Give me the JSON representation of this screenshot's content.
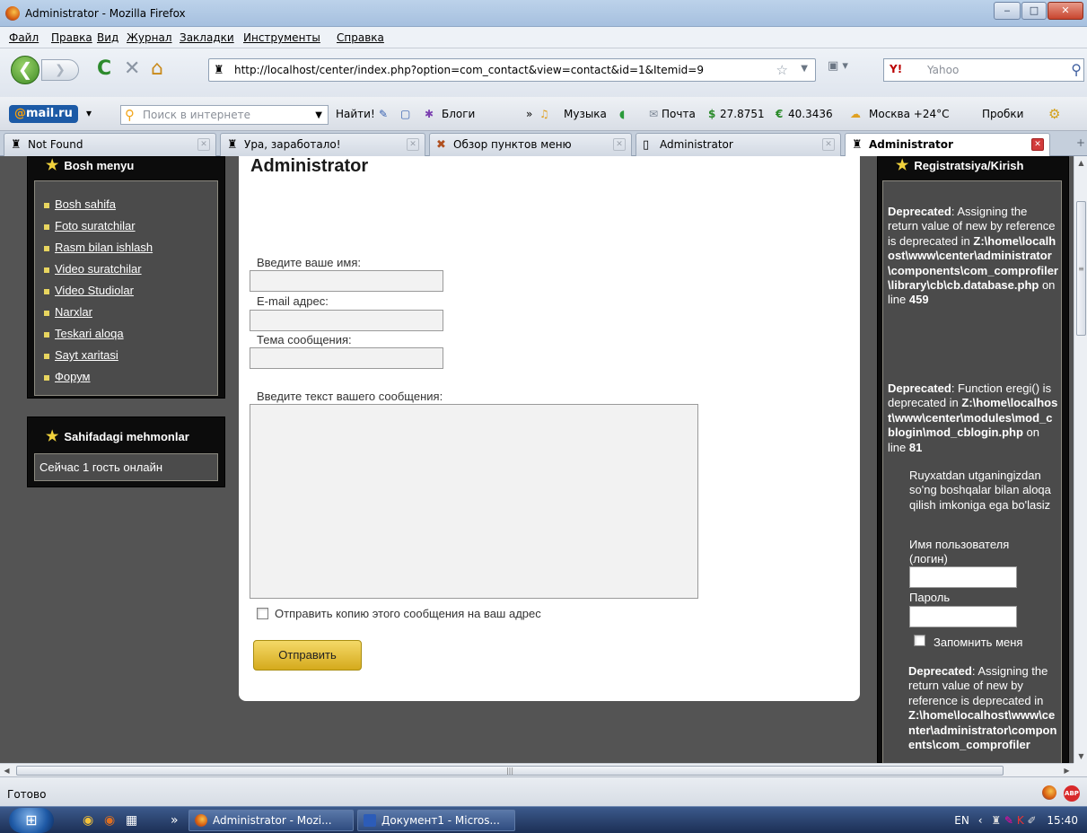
{
  "window": {
    "title": "Administrator - Mozilla Firefox",
    "min": "‒",
    "max": "□",
    "close": "✕"
  },
  "menubar": [
    "Файл",
    "Правка",
    "Вид",
    "Журнал",
    "Закладки",
    "Инструменты",
    "Справка"
  ],
  "nav": {
    "back": "❮",
    "forward": "❯",
    "reload": "C",
    "stop": "✕",
    "home": "⌂",
    "url": "http://localhost/center/index.php?option=com_contact&view=contact&id=1&Itemid=9",
    "star": "☆",
    "search_engine": "Y!",
    "search_placeholder": "Yahoo",
    "search_icon": "⚲"
  },
  "mailbar": {
    "logo_at": "@",
    "logo_text": "mail.ru",
    "search_placeholder": "Поиск в интернете",
    "find": "Найти!",
    "blogs": "Блоги",
    "music": "Музыка",
    "mail": "Почта",
    "usd": "27.8751",
    "eur": "40.3436",
    "weather": "Москва +24°C",
    "traffic": "Пробки"
  },
  "tabs": [
    {
      "label": "Not Found",
      "icon": "♜"
    },
    {
      "label": "Ура, заработало!",
      "icon": "♜"
    },
    {
      "label": "Обзор пунктов меню",
      "icon": "✖"
    },
    {
      "label": "Administrator",
      "icon": "▯"
    },
    {
      "label": "Administrator",
      "icon": "♜"
    }
  ],
  "tab_close": "✕",
  "tab_new": "+",
  "sidebar": {
    "menu_title": "Bosh menyu",
    "menu_items": [
      "Bosh sahifa",
      "Foto suratchilar",
      "Rasm bilan ishlash",
      "Video suratchilar",
      "Video Studiolar",
      "Narxlar",
      "Teskari aloqa",
      "Sayt xaritasi",
      "Форум"
    ],
    "guests_title": "Sahifadagi mehmonlar",
    "guests_text": "Сейчас 1 гость онлайн"
  },
  "form": {
    "title": "Administrator",
    "name_label": "Введите ваше имя:",
    "email_label": "E-mail адрес:",
    "subject_label": "Тема сообщения:",
    "message_label": "Введите текст вашего сообщения:",
    "copy_label": "Отправить копию этого сообщения на ваш адрес",
    "send_button": "Отправить"
  },
  "right": {
    "title": "Registratsiya/Kirish",
    "dep1_word": "Deprecated",
    "dep1_a": ": Assigning the return value of new by reference is deprecated in",
    "dep1_path": "Z:\\home\\localhost\\www\\center\\administrator\\components\\com_comprofiler\\library\\cb\\cb.database.php",
    "dep1_b": "on line",
    "dep1_line": "459",
    "dep2_word": "Deprecated",
    "dep2_a": ": Function eregi() is deprecated in",
    "dep2_path": "Z:\\home\\localhost\\www\\center\\modules\\mod_cblogin\\mod_cblogin.php",
    "dep2_b": "on line",
    "dep2_line": "81",
    "info": "Ruyxatdan utganingizdan so'ng boshqalar bilan aloqa qilish imkoniga ega bo'lasiz",
    "username_label": "Имя пользователя (логин)",
    "password_label": "Пароль",
    "remember_label": "Запомнить меня",
    "dep3_word": "Deprecated",
    "dep3_a": ": Assigning the return value of new by reference is deprecated in",
    "dep3_path": "Z:\\home\\localhost\\www\\center\\administrator\\components\\com_comprofiler"
  },
  "scroll": {
    "up": "▲",
    "down": "▼",
    "left": "◀",
    "right": "▶",
    "grip": "≡",
    "hgrip": "|||"
  },
  "status": {
    "text": "Готово",
    "abp": "ABP"
  },
  "taskbar": {
    "start_icon": "⊞",
    "quicklaunch": [
      "◉",
      "◉",
      "▦",
      "»"
    ],
    "tasks": [
      "Administrator - Mozi...",
      "Документ1 - Micros..."
    ],
    "lang": "EN",
    "clock": "15:40"
  }
}
